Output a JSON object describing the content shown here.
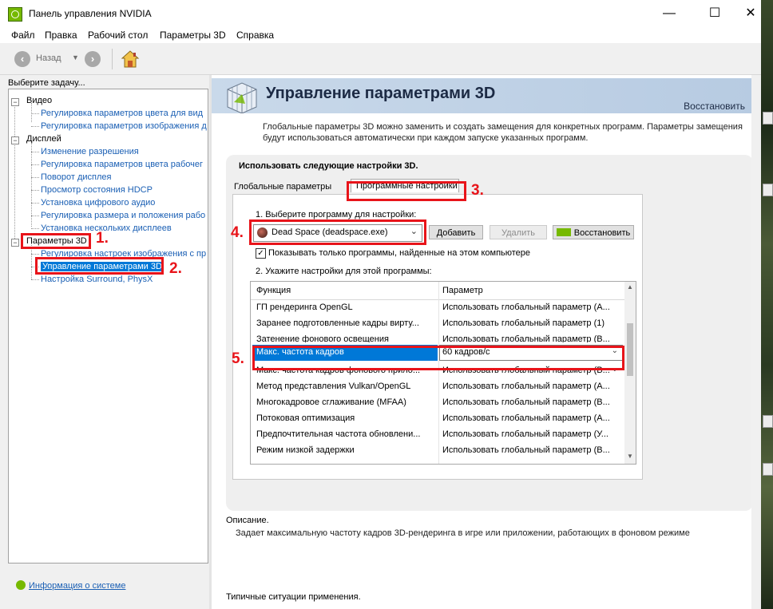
{
  "window": {
    "title": "Панель управления NVIDIA",
    "controls": {
      "minimize": "—",
      "maximize": "☐",
      "close": "✕"
    }
  },
  "menu": [
    "Файл",
    "Правка",
    "Рабочий стол",
    "Параметры 3D",
    "Справка"
  ],
  "toolbar": {
    "back_label": "Назад",
    "back_icon": "back-arrow-icon",
    "forward_icon": "forward-arrow-icon",
    "home_icon": "home-icon"
  },
  "sidebar": {
    "caption": "Выберите задачу...",
    "tree": [
      {
        "label": "Видео",
        "type": "category"
      },
      {
        "label": "Регулировка параметров цвета для вид",
        "type": "link"
      },
      {
        "label": "Регулировка параметров изображения д",
        "type": "link"
      },
      {
        "label": "Дисплей",
        "type": "category"
      },
      {
        "label": "Изменение разрешения",
        "type": "link"
      },
      {
        "label": "Регулировка параметров цвета рабочег",
        "type": "link"
      },
      {
        "label": "Поворот дисплея",
        "type": "link"
      },
      {
        "label": "Просмотр состояния HDCP",
        "type": "link"
      },
      {
        "label": "Установка цифрового аудио",
        "type": "link"
      },
      {
        "label": "Регулировка размера и положения рабо",
        "type": "link"
      },
      {
        "label": "Установка нескольких дисплеев",
        "type": "link"
      },
      {
        "label": "Параметры 3D",
        "type": "category"
      },
      {
        "label": "Регулировка настроек изображения с пр",
        "type": "link"
      },
      {
        "label": "Управление параметрами 3D",
        "type": "link"
      },
      {
        "label": "Настройка Surround, PhysX",
        "type": "link"
      }
    ],
    "system_info": "Информация о системе"
  },
  "page": {
    "title": "Управление параметрами 3D",
    "restore": "Восстановить",
    "description": "Глобальные параметры 3D можно заменить и создать замещения для конкретных программ. Параметры замещения будут использоваться автоматически при каждом запуске указанных программ.",
    "section_title": "Использовать следующие настройки 3D.",
    "tabs": [
      "Глобальные параметры",
      "Программные настройки"
    ],
    "step1": "1. Выберите программу для настройки:",
    "program_selected": "Dead Space (deadspace.exe)",
    "buttons": {
      "add": "Добавить",
      "delete": "Удалить",
      "restore": "Восстановить"
    },
    "checkbox_label": "Показывать только программы, найденные на этом компьютере",
    "checkbox_checked": true,
    "step2": "2. Укажите настройки для этой программы:",
    "table": {
      "headers": [
        "Функция",
        "Параметр"
      ],
      "rows": [
        [
          "ГП рендеринга OpenGL",
          "Использовать глобальный параметр (А..."
        ],
        [
          "Заранее подготовленные кадры вирту...",
          "Использовать глобальный параметр (1)"
        ],
        [
          "Затенение фонового освещения",
          "Использовать глобальный параметр (В..."
        ],
        [
          "Макс. частота кадров",
          "60 кадров/с"
        ],
        [
          "Макс. частота кадров фонового прило...",
          "Использовать глобальный параметр (В..."
        ],
        [
          "Метод представления Vulkan/OpenGL",
          "Использовать глобальный параметр (А..."
        ],
        [
          "Многокадровое сглаживание (MFAA)",
          "Использовать глобальный параметр (В..."
        ],
        [
          "Потоковая оптимизация",
          "Использовать глобальный параметр (А..."
        ],
        [
          "Предпочтительная частота обновлени...",
          "Использовать глобальный параметр (У..."
        ],
        [
          "Режим низкой задержки",
          "Использовать глобальный параметр (В..."
        ]
      ],
      "selected_index": 3
    },
    "description_label": "Описание.",
    "description_text": "Задает максимальную частоту кадров 3D-рендеринга в игре или приложении, работающих в фоновом режиме",
    "usage_label": "Типичные ситуации применения."
  },
  "annotations": [
    "1.",
    "2.",
    "3.",
    "4.",
    "5."
  ],
  "colors": {
    "accent_green": "#76b900",
    "selection": "#0078d7",
    "link": "#1a5fb4",
    "annotation_red": "#e8141a",
    "banner": "#c9d9ea"
  }
}
